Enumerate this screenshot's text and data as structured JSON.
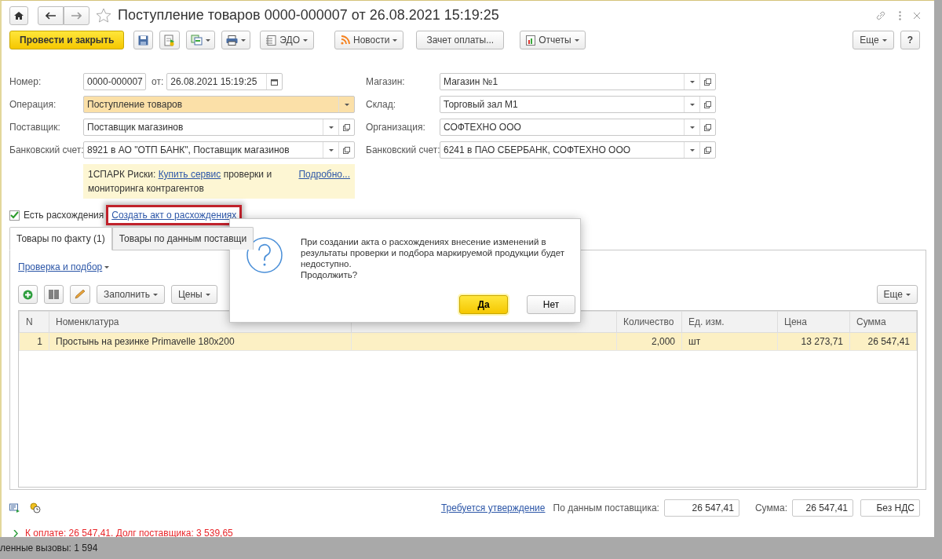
{
  "window": {
    "title": "Поступление товаров 0000-000007 от 26.08.2021 15:19:25",
    "starred": false
  },
  "toolbar": {
    "post_button": "Провести и закрыть",
    "menu_buttons": [
      {
        "label": "ЭДО",
        "dropdown": true
      },
      {
        "label": "Новости",
        "dropdown": true
      },
      {
        "label": "Зачет оплаты...",
        "dropdown": false
      },
      {
        "label": "Отчеты",
        "dropdown": true
      }
    ],
    "more_button": "Еще",
    "help_button": "?"
  },
  "number_row": {
    "label": "Номер:",
    "number": "0000-000007",
    "date_label": "от:",
    "date": "26.08.2021 15:19:25"
  },
  "left_fields": [
    {
      "label": "Операция:",
      "value": "Поступление товаров",
      "highlighted": true,
      "open_button": false
    },
    {
      "label": "Поставщик:",
      "value": "Поставщик магазинов",
      "highlighted": false,
      "open_button": true
    },
    {
      "label": "Банковский счет:",
      "value": "8921 в АО \"ОТП БАНК\", Поставщик магазинов",
      "highlighted": false,
      "open_button": true
    }
  ],
  "right_fields": [
    {
      "label": "Магазин:",
      "value": "Магазин №1",
      "highlighted": false,
      "open_button": true
    },
    {
      "label": "Склад:",
      "value": "Торговый зал М1",
      "highlighted": false,
      "open_button": true
    },
    {
      "label": "Организация:",
      "value": "СОФТЕХНО ООО",
      "highlighted": false,
      "open_button": true
    },
    {
      "label": "Банковский счет:",
      "value": "6241 в ПАО СБЕРБАНК, СОФТЕХНО ООО",
      "highlighted": false,
      "open_button": true
    }
  ],
  "notice": {
    "prefix": "1СПАРК Риски:",
    "link": "Купить сервис",
    "suffix": "проверки и мониторинга контрагентов",
    "more_link": "Подробно..."
  },
  "discrepancy": {
    "label": "Есть расхождения",
    "checked": true,
    "link": "Создать акт о расхождениях",
    "highlighted": true
  },
  "tabs": [
    {
      "label": "Товары по факту (1)",
      "selected": true
    },
    {
      "label": "Товары по данным поставщи",
      "selected": false
    }
  ],
  "check_link": "Проверка и подбор",
  "table_toolbar": {
    "buttons": [
      "Заполнить",
      "Цены"
    ],
    "more_button": "Еще"
  },
  "table": {
    "columns": [
      "N",
      "Номенклатура",
      "Количество",
      "Ед. изм.",
      "Цена",
      "Сумма"
    ],
    "rows": [
      {
        "cells": [
          "1",
          "Простынь на резинке Primavelle 180x200",
          "2,000",
          "шт",
          "13 273,71",
          "26 547,41"
        ],
        "selected": true
      }
    ]
  },
  "footer": {
    "approval_link": "Требуется утверждение",
    "supplier_label": "По данным поставщика:",
    "supplier_value": "26 547,41",
    "sum_label": "Сумма:",
    "sum_value": "26 547,41",
    "vat_value": "Без НДС"
  },
  "payment": {
    "text": "К оплате: 26 547,41. Долг поставщика: 3 539,65",
    "expanded": false
  },
  "status_bar": "ленные вызовы: 1 594",
  "dialog": {
    "paragraphs": [
      "При создании акта о расхождениях внесение изменений в результаты проверки и подбора маркируемой продукции будет недоступно.",
      "Продолжить?"
    ],
    "buttons": [
      {
        "label": "Да",
        "default": true
      },
      {
        "label": "Нет",
        "default": false
      }
    ]
  }
}
